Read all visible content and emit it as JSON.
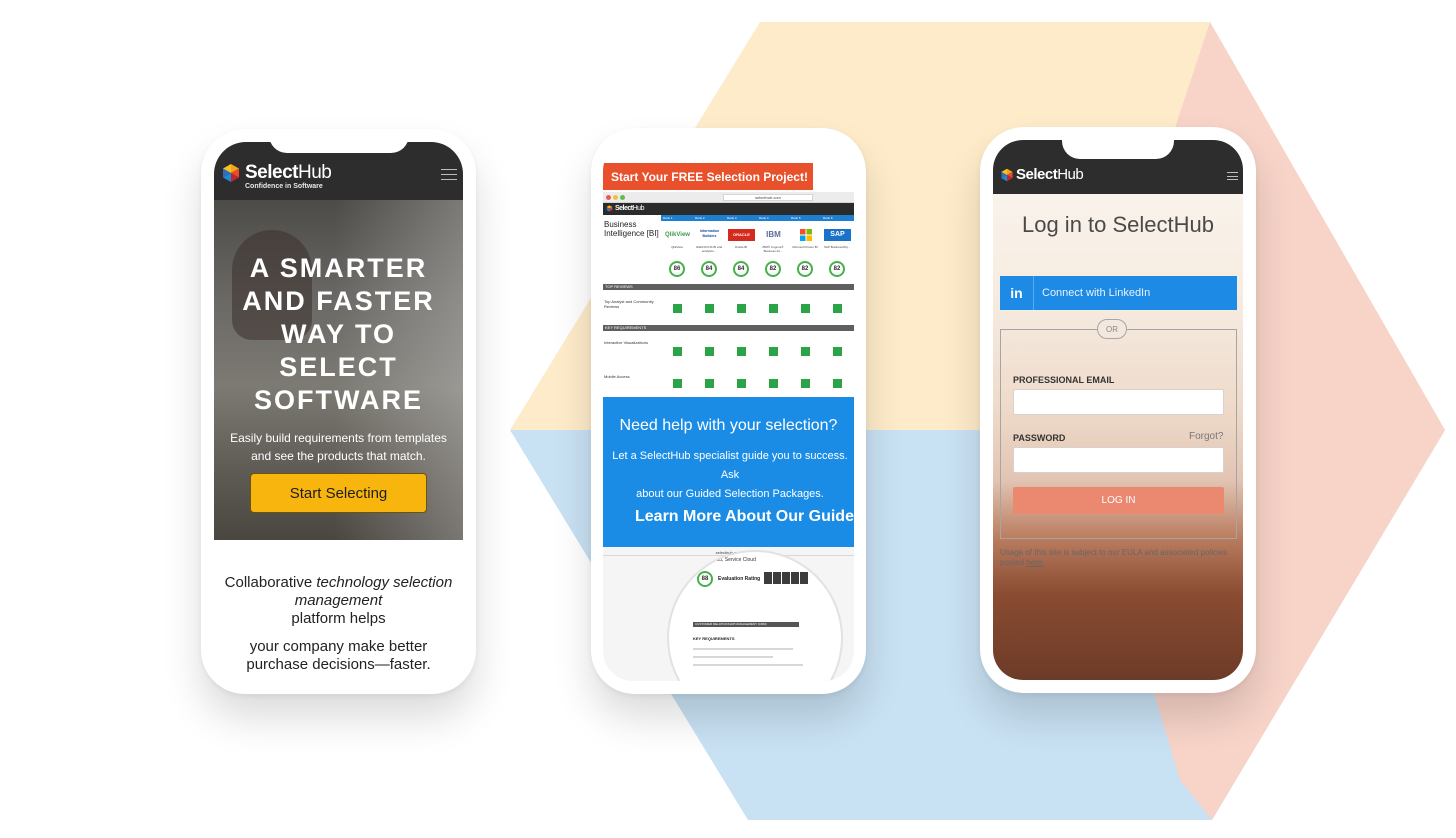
{
  "phone1": {
    "logo_bold": "Select",
    "logo_light": "Hub",
    "tagline": "Confidence in Software",
    "hero_title_lines": [
      "A SMARTER",
      "AND FASTER",
      "WAY TO",
      "SELECT",
      "SOFTWARE"
    ],
    "hero_sub_line1": "Easily build requirements from templates",
    "hero_sub_line2": "and see the products that match.",
    "cta_label": "Start Selecting",
    "collab_prefix": "Collaborative ",
    "collab_em": "technology selection management",
    "collab_suffix": "platform helps",
    "collab_line2": "your company make better",
    "collab_line3": "purchase decisions—faster."
  },
  "phone2": {
    "banner": "Start Your FREE Selection Project!",
    "url": "selecthub.com",
    "app_logo_bold": "Select",
    "app_logo_light": "Hub",
    "category_title": "Business Intelligence [BI]",
    "rank_labels": [
      "Rank 1",
      "Rank 2",
      "Rank 3",
      "Rank 4",
      "Rank 5",
      "Rank 6"
    ],
    "vendors": [
      {
        "logo": "QlikView",
        "name": "QlikView",
        "score": "86",
        "color": "#3d9b4a"
      },
      {
        "logo": "Information Builders",
        "name": "WebFOCUS BI and analytics...",
        "score": "84",
        "color": "#1b4aa0"
      },
      {
        "logo": "ORACLE",
        "name": "Oracle BI",
        "score": "84",
        "color": "#d52b1e"
      },
      {
        "logo": "IBM",
        "name": "IBM® Cognos® Business Int...",
        "score": "82",
        "color": "#5b6f9a"
      },
      {
        "logo": "Microsoft",
        "name": "Microsoft Power BI",
        "score": "82",
        "color": "#f25022"
      },
      {
        "logo": "SAP",
        "name": "SAP BusinessObj...",
        "score": "82",
        "color": "#1a72c9"
      }
    ],
    "strip_top_reviews": "TOP REVIEWS",
    "row_top_analyst": "Top Analyst and Community Reviews",
    "strip_key_requirements": "KEY REQUIREMENTS",
    "row_interactive": "Interactive Visualizations",
    "row_mobile": "Mobile Access",
    "need_help": "Need help with your selection?",
    "let_line1": "Let a SelectHub specialist guide you to success. Ask",
    "let_line2": "about our Guided Selection Packages.",
    "learn_more": "Learn More About Our Guide",
    "shot_url": "selecthub.com",
    "circle_title": "Sales Cloud, Service Cloud",
    "circle_score": "88",
    "circle_eval": "Evaluation Rating",
    "circle_bar1": "CUSTOMER RELATIONSHIP MANAGEMENT (CRM)",
    "circle_key": "KEY REQUIREMENTS"
  },
  "phone3": {
    "logo_bold": "Select",
    "logo_light": "Hub",
    "title": "Log in to SelectHub",
    "linkedin_icon": "in",
    "linkedin_label": "Connect with LinkedIn",
    "or_label": "OR",
    "email_label": "PROFESSIONAL EMAIL",
    "password_label": "PASSWORD",
    "forgot_label": "Forgot?",
    "login_label": "LOG IN",
    "usage_text": "Usage of this site is subject to our EULA and associated policies posted ",
    "usage_link": "here."
  },
  "colors": {
    "bg_yellow": "#fdebc9",
    "bg_blue": "#c8e1f3",
    "bg_pink": "#f7d3c8",
    "cta_yellow": "#f8b50d",
    "banner_orange": "#e8512b",
    "promo_blue": "#1a8ce6",
    "linkedin_blue": "#1d8ae6",
    "login_salmon": "#ea8870"
  }
}
